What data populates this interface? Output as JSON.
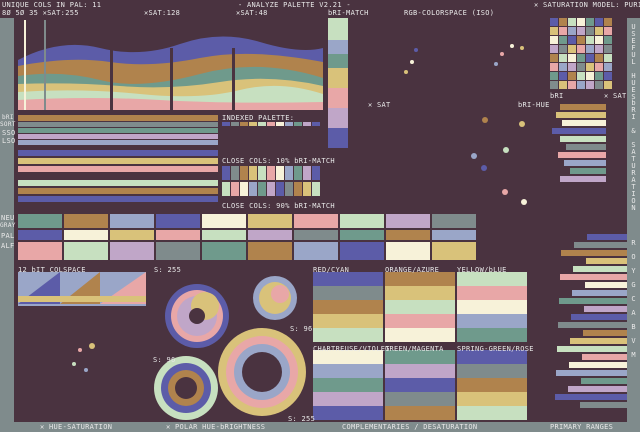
{
  "header": {
    "unique_cols": "UNIQUE COLS IN PAL: 11",
    "sat_levels": "8Ø 5Ø 35 ✕SAT:255",
    "sat128": "✕SAT:128",
    "sat48": "✕SAT:48",
    "app_title": "- ANALYZE PALETTE V2.21 -",
    "bri_match": "bRI-MATCH",
    "colorspace": "RGB-COLORSPACE (ISO)",
    "sat_model": "✕ SATURATION MODEL: PURITY"
  },
  "left_labels": {
    "bri_sort_1": "bRI",
    "bri_sort_2": "SORT",
    "sso": "SSO",
    "lso": "LSO",
    "neu": "NEU",
    "gray": "GRAY",
    "pal": "PAL",
    "alf": "ALF"
  },
  "center": {
    "indexed_palette": "INDEXED PALETTE:",
    "close_cols_10": "CLOSE COLS: 10% bRI-MATCH",
    "close_cols_90": "CLOSE COLS: 90% bRI-MATCH",
    "x_sat": "✕ SAT",
    "bri_hue": "bRI-HUE",
    "bri_label": "bRI",
    "sat_label": "✕ SAT"
  },
  "right_vertical": {
    "useful_hues": "USEFUL HUES",
    "bri_saturation": "bRI & SATURATION",
    "roygcabvm": "ROYGCABVM"
  },
  "lower": {
    "colspace_12bit": "12 bIT COLSPACE",
    "s255_top": "S: 255",
    "s96_small": "S: 96",
    "s96_left": "S: 96",
    "s255_bottom": "S: 255",
    "red_cyan": "RED/CYAN",
    "orange_azure": "ORANGE/AZURE",
    "yellow_blue": "YELLOW/bLUE",
    "chartreuse_violet": "CHARTREUSE/VIOLET",
    "green_magenta": "GREEN/MAGENTA",
    "spring_rose": "SPRING-GREEN/ROSE"
  },
  "footer": {
    "hue_saturation": "✕ HUE-SATURATION",
    "polar": "✕ POLAR HUE-bRIGHTNESS",
    "complementaries": "COMPLEMENTARIES / DESATURATION",
    "primary_ranges": "PRIMARY RANGES"
  },
  "palette": [
    "#4a3340",
    "#5c5ca8",
    "#7f8b8c",
    "#b0834d",
    "#d9c27a",
    "#c7e0c0",
    "#e8a7a7",
    "#f7f2d9",
    "#9aa6c8",
    "#6f9a8c",
    "#c0a6c8"
  ]
}
